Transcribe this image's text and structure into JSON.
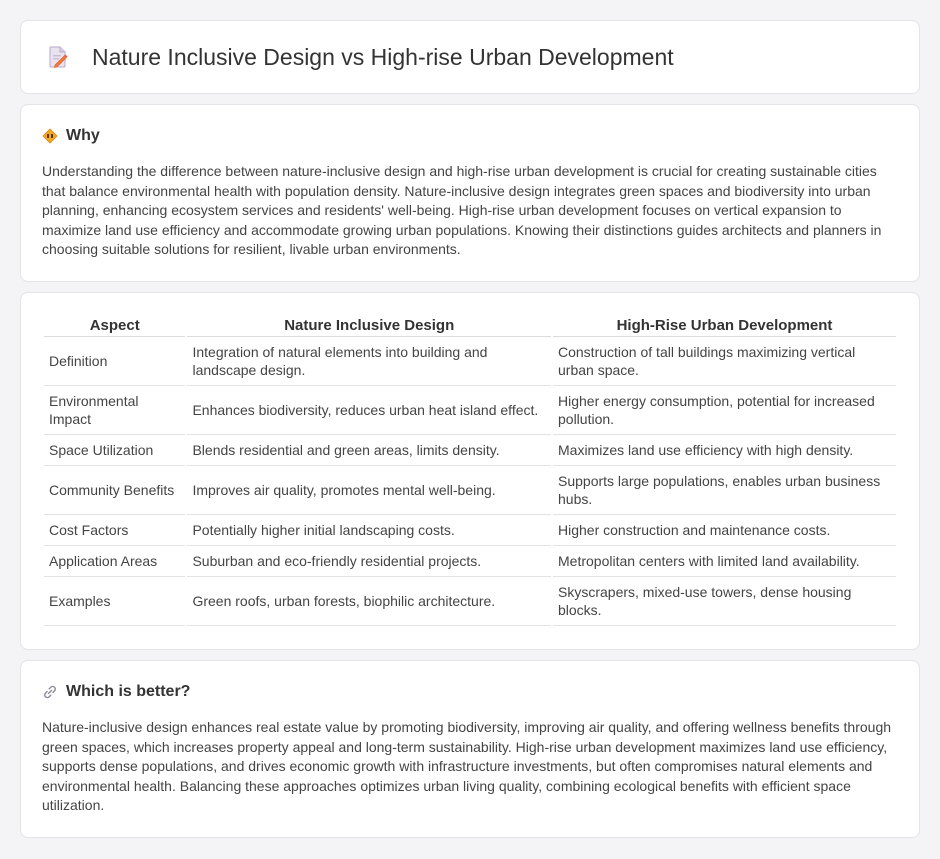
{
  "header": {
    "title": "Nature Inclusive Design vs High-rise Urban Development",
    "icon": "document-edit-icon"
  },
  "why": {
    "title": "Why",
    "icon": "diamond-sign-icon",
    "text": "Understanding the difference between nature-inclusive design and high-rise urban development is crucial for creating sustainable cities that balance environmental health with population density. Nature-inclusive design integrates green spaces and biodiversity into urban planning, enhancing ecosystem services and residents' well-being. High-rise urban development focuses on vertical expansion to maximize land use efficiency and accommodate growing urban populations. Knowing their distinctions guides architects and planners in choosing suitable solutions for resilient, livable urban environments."
  },
  "table": {
    "headers": [
      "Aspect",
      "Nature Inclusive Design",
      "High-Rise Urban Development"
    ],
    "rows": [
      [
        "Definition",
        "Integration of natural elements into building and landscape design.",
        "Construction of tall buildings maximizing vertical urban space."
      ],
      [
        "Environmental Impact",
        "Enhances biodiversity, reduces urban heat island effect.",
        "Higher energy consumption, potential for increased pollution."
      ],
      [
        "Space Utilization",
        "Blends residential and green areas, limits density.",
        "Maximizes land use efficiency with high density."
      ],
      [
        "Community Benefits",
        "Improves air quality, promotes mental well-being.",
        "Supports large populations, enables urban business hubs."
      ],
      [
        "Cost Factors",
        "Potentially higher initial landscaping costs.",
        "Higher construction and maintenance costs."
      ],
      [
        "Application Areas",
        "Suburban and eco-friendly residential projects.",
        "Metropolitan centers with limited land availability."
      ],
      [
        "Examples",
        "Green roofs, urban forests, biophilic architecture.",
        "Skyscrapers, mixed-use towers, dense housing blocks."
      ]
    ]
  },
  "better": {
    "title": "Which is better?",
    "icon": "link-icon",
    "text": "Nature-inclusive design enhances real estate value by promoting biodiversity, improving air quality, and offering wellness benefits through green spaces, which increases property appeal and long-term sustainability. High-rise urban development maximizes land use efficiency, supports dense populations, and drives economic growth with infrastructure investments, but often compromises natural elements and environmental health. Balancing these approaches optimizes urban living quality, combining ecological benefits with efficient space utilization."
  }
}
